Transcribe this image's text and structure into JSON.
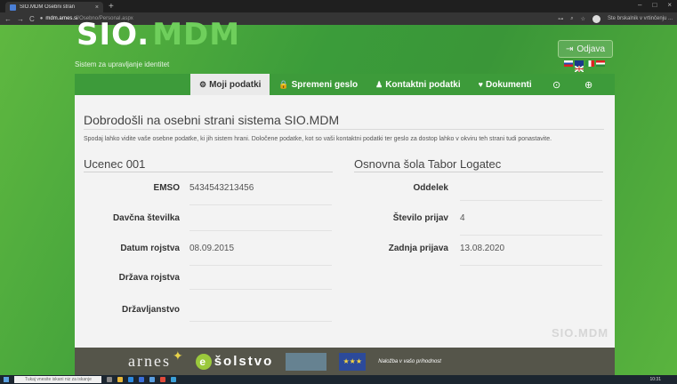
{
  "browser": {
    "tab_title": "SIO.MDM Osebni stran",
    "tab_close": "×",
    "new_tab": "+",
    "url_domain": "mdm.arnes.si",
    "url_path": "/Osebno/Personal.aspx",
    "nav_back": "←",
    "nav_forward": "→",
    "nav_reload": "C",
    "window_controls": [
      "–",
      "□",
      "×"
    ],
    "profile_label": "Ste brskalnik v vrtinčenju ... "
  },
  "header": {
    "logo_part1": "SIO.",
    "logo_part2": "MDM",
    "subtitle": "Sistem za upravljanje identitet",
    "logout_label": "Odjava",
    "logout_icon": "sign-out-icon"
  },
  "menu": {
    "items": [
      {
        "label": "Moji podatki",
        "icon": "⚙"
      },
      {
        "label": "Spremeni geslo",
        "icon": "🔒"
      },
      {
        "label": "Kontaktni podatki",
        "icon": "♟"
      },
      {
        "label": "Dokumenti",
        "icon": "♥"
      }
    ],
    "extra_icons": [
      "⊙",
      "⊕"
    ]
  },
  "content": {
    "welcome": "Dobrodošli na osebni strani sistema SIO.MDM",
    "description": "Spodaj lahko vidite vaše osebne podatke, ki jih sistem hrani. Določene podatke, kot so vaši kontaktni podatki ter geslo za dostop lahko v okviru teh strani tudi ponastavite.",
    "user_name": "Ucenec 001",
    "school_name": "Osnovna šola Tabor Logatec",
    "left_fields": [
      {
        "label": "EMSO",
        "value": "5434543213456"
      },
      {
        "label": "Davčna številka",
        "value": ""
      },
      {
        "label": "Datum rojstva",
        "value": "08.09.2015"
      },
      {
        "label": "Država rojstva",
        "value": ""
      },
      {
        "label": "Državljanstvo",
        "value": ""
      }
    ],
    "right_fields": [
      {
        "label": "Oddelek",
        "value": ""
      },
      {
        "label": "Število prijav",
        "value": "4"
      },
      {
        "label": "Zadnja prijava",
        "value": "13.08.2020"
      }
    ],
    "watermark": "SIO.MDM"
  },
  "footer": {
    "arnes": "arnes",
    "solstvo": "šolstvo",
    "eu_text": "★★★",
    "investment_text": "Naložba v vašo prihodnost"
  },
  "taskbar": {
    "search_placeholder": "Tukaj vnesite iskani niz za iskanje",
    "time": "10:31"
  },
  "colors": {
    "brand_green": "#3d9b3a",
    "background": "#f3f3f3"
  }
}
